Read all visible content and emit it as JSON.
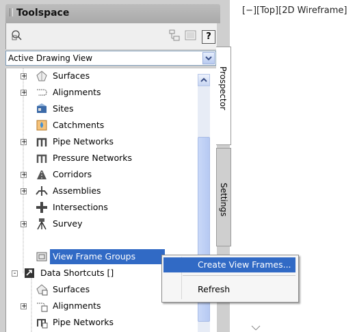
{
  "toolspace": {
    "title": "Toolspace"
  },
  "dropdown": {
    "value": "Active Drawing View"
  },
  "tree": {
    "items": [
      {
        "label": "Surfaces",
        "icon": "surfaces-icon",
        "expander": "+"
      },
      {
        "label": "Alignments",
        "icon": "alignments-icon",
        "expander": "+"
      },
      {
        "label": "Sites",
        "icon": "sites-icon",
        "expander": ""
      },
      {
        "label": "Catchments",
        "icon": "catchments-icon",
        "expander": ""
      },
      {
        "label": "Pipe Networks",
        "icon": "pipe-networks-icon",
        "expander": "+"
      },
      {
        "label": "Pressure Networks",
        "icon": "pressure-networks-icon",
        "expander": ""
      },
      {
        "label": "Corridors",
        "icon": "corridors-icon",
        "expander": "+"
      },
      {
        "label": "Assemblies",
        "icon": "assemblies-icon",
        "expander": "+"
      },
      {
        "label": "Intersections",
        "icon": "intersections-icon",
        "expander": ""
      },
      {
        "label": "Survey",
        "icon": "survey-icon",
        "expander": "+"
      },
      {
        "label": "View Frame Groups",
        "icon": "view-frame-groups-icon",
        "expander": ""
      },
      {
        "label": "Data Shortcuts []",
        "icon": "data-shortcuts-icon",
        "expander": "-"
      },
      {
        "label": "Surfaces",
        "icon": "shortcut-surfaces-icon",
        "expander": ""
      },
      {
        "label": "Alignments",
        "icon": "shortcut-alignments-icon",
        "expander": "+"
      },
      {
        "label": "Pipe Networks",
        "icon": "shortcut-pipe-networks-icon",
        "expander": ""
      }
    ]
  },
  "tabs": {
    "prospector": "Prospector",
    "settings": "Settings"
  },
  "viewport": {
    "label": "[−][Top][2D Wireframe]"
  },
  "context_menu": {
    "items": [
      "Create View Frames...",
      "Refresh"
    ]
  },
  "colors": {
    "selection": "#316ac5",
    "palette_bg": "#cfcfcf"
  }
}
